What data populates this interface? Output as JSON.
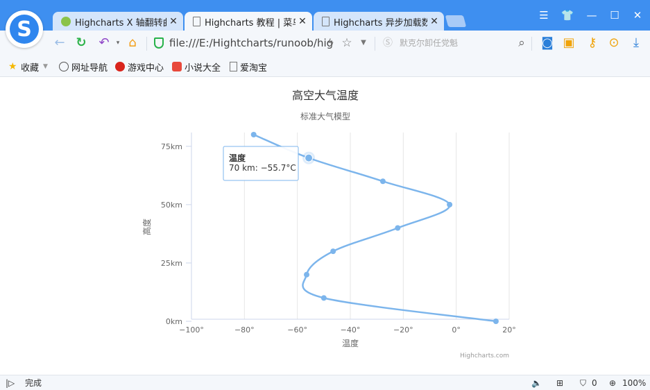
{
  "browser": {
    "tabs": [
      {
        "title": "Highcharts X 轴翻转曲",
        "active": false
      },
      {
        "title": "Highcharts 教程 | 菜鸟",
        "active": true
      },
      {
        "title": "Highcharts 异步加载数",
        "active": false
      }
    ],
    "url": "file:///E:/Hightcharts/runoob/hig",
    "search_placeholder": "默克尔卸任党魁",
    "bookmarks": [
      "收藏",
      "网址导航",
      "游戏中心",
      "小说大全",
      "爱淘宝"
    ],
    "status_text": "完成",
    "badge_count": "0",
    "zoom": "100%",
    "colors": {
      "tabbar": "#3e8ff0",
      "series": "#7cb5ec"
    }
  },
  "chart_data": {
    "type": "line",
    "title": "高空大气温度",
    "subtitle": "标准大气模型",
    "xlabel": "温度",
    "ylabel": "高度",
    "xlim": [
      -100,
      20
    ],
    "ylim": [
      0,
      80
    ],
    "x_ticks": [
      "−100°",
      "−80°",
      "−60°",
      "−40°",
      "−20°",
      "0°",
      "20°"
    ],
    "y_ticks": [
      "0km",
      "25km",
      "50km",
      "75km"
    ],
    "inverted_axes": true,
    "series": [
      {
        "color": "#7cb5ec",
        "points": [
          {
            "altitude": 0,
            "temperature": 15
          },
          {
            "altitude": 10,
            "temperature": -50
          },
          {
            "altitude": 20,
            "temperature": -56.5
          },
          {
            "altitude": 30,
            "temperature": -46.5
          },
          {
            "altitude": 40,
            "temperature": -22.1
          },
          {
            "altitude": 50,
            "temperature": -2.5
          },
          {
            "altitude": 60,
            "temperature": -27.7
          },
          {
            "altitude": 70,
            "temperature": -55.7
          },
          {
            "altitude": 80,
            "temperature": -76.5
          }
        ]
      }
    ],
    "tooltip": {
      "title": "温度",
      "text": "70 km: −55.7°C",
      "point_index": 7
    },
    "credits": "Highcharts.com"
  }
}
